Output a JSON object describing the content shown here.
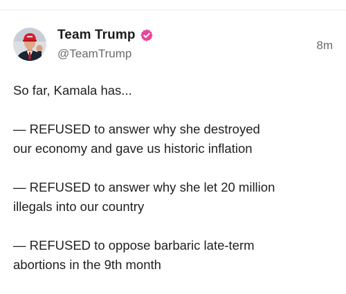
{
  "post": {
    "author": {
      "display_name": "Team Trump",
      "handle": "@TeamTrump",
      "verified_icon": "verified-badge-icon",
      "badge_color": "#e8459a",
      "avatar_icon": "avatar-photo"
    },
    "timestamp": "8m",
    "paragraphs": [
      "So far, Kamala has...",
      "— REFUSED to answer why she destroyed\nour economy and gave us historic inflation",
      "— REFUSED to answer why she let 20 million\nillegals into our country",
      "— REFUSED to oppose barbaric late-term\nabortions in the 9th month"
    ]
  }
}
